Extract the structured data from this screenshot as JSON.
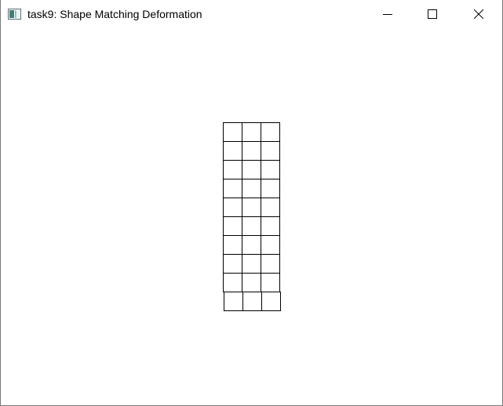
{
  "window": {
    "title": "task9: Shape Matching Deformation",
    "controls": {
      "minimize_icon": "minimize-icon",
      "maximize_icon": "maximize-icon",
      "close_icon": "close-icon"
    }
  },
  "scene": {
    "grid_columns": 3,
    "grid_rows": 10,
    "line_color": "#000000",
    "background": "#ffffff"
  }
}
